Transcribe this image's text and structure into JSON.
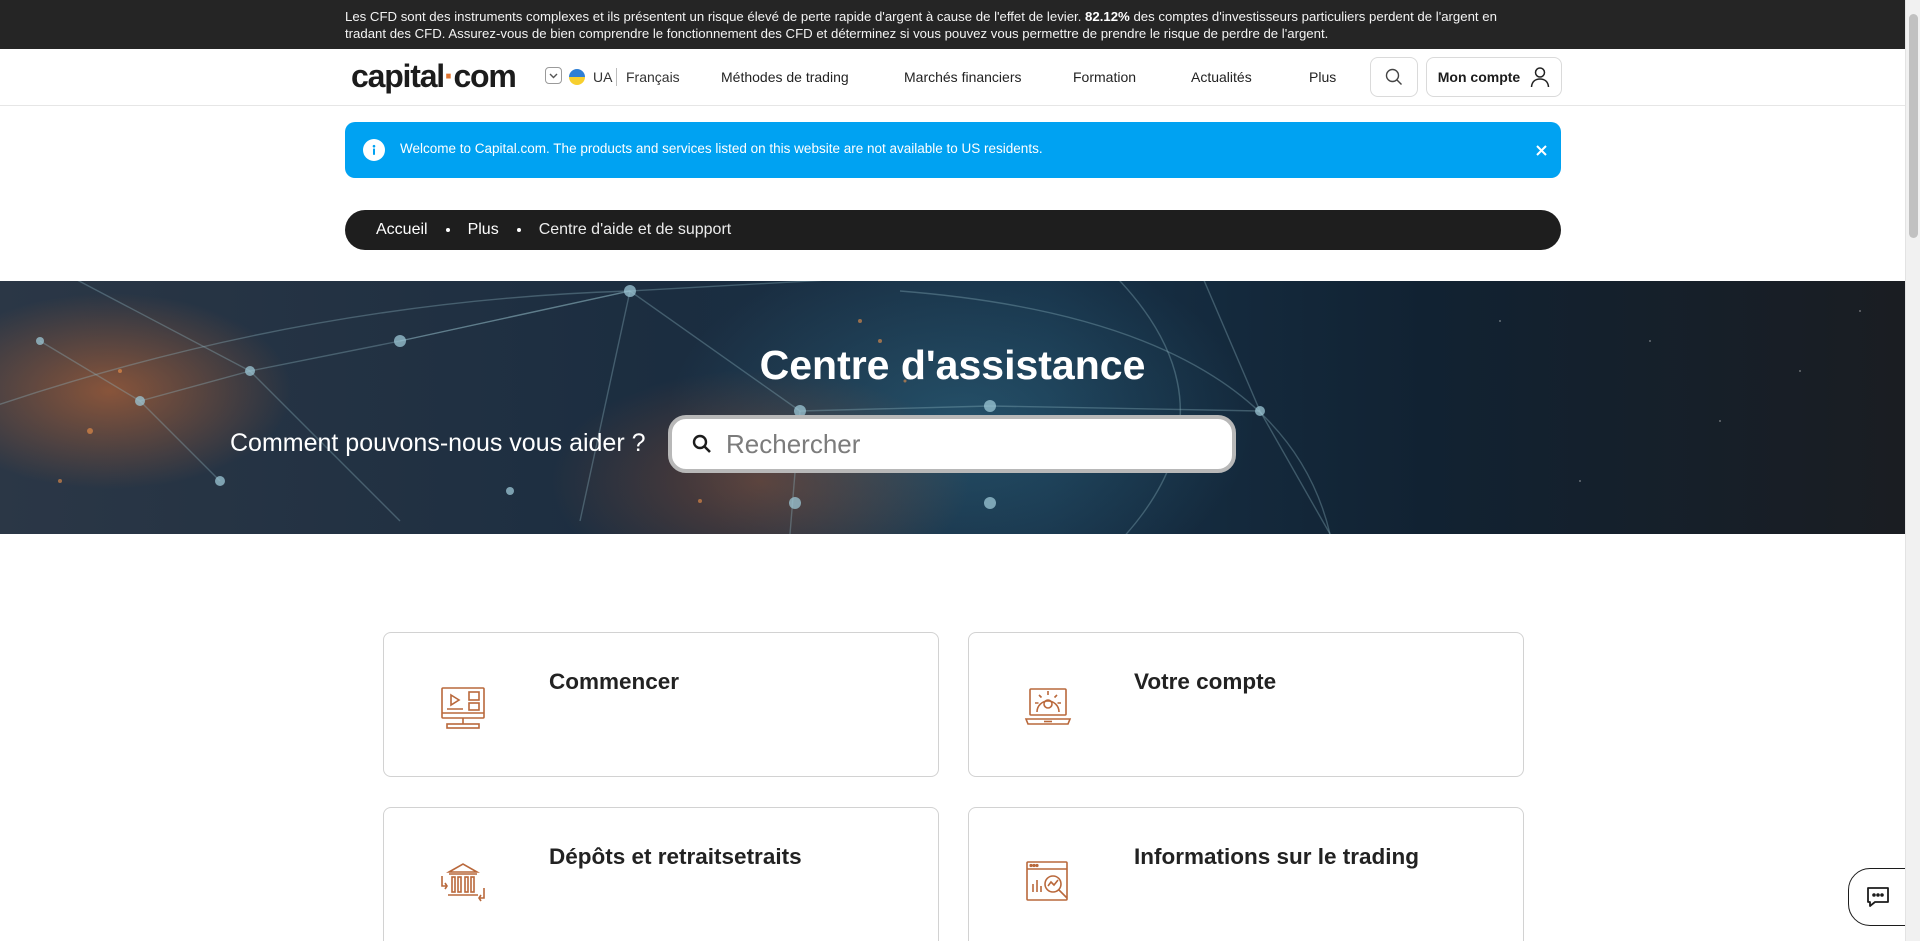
{
  "risk_warning": {
    "text_before": "Les CFD sont des instruments complexes et ils présentent un risque élevé de perte rapide d'argent à cause de l'effet de levier. ",
    "percentage": "82.12%",
    "text_after": " des comptes d'investisseurs particuliers perdent de l'argent en tradant des CFD. Assurez-vous de bien comprendre le fonctionnement des CFD et déterminez si vous pouvez vous permettre de prendre le risque de perdre de l'argent."
  },
  "header": {
    "logo_left": "capital",
    "logo_dot": "·",
    "logo_right": "com",
    "region_code": "UA",
    "language": "Français",
    "nav": [
      "Méthodes de trading",
      "Marchés financiers",
      "Formation",
      "Actualités",
      "Plus"
    ],
    "account_label": "Mon compte",
    "icons": {
      "search": "search-icon",
      "account": "user-icon",
      "region": "chevron-down-icon",
      "flag": "ukraine-flag-icon"
    }
  },
  "info_banner": {
    "text": "Welcome to Capital.com. The products and services listed on this website are not available to US residents.",
    "close_label": "×",
    "color": "#00a2f2"
  },
  "breadcrumb": [
    "Accueil",
    "Plus",
    "Centre d'aide et de support"
  ],
  "hero": {
    "title": "Centre d'assistance",
    "question": "Comment pouvons-nous vous aider ?",
    "search_placeholder": "Rechercher",
    "search_value": ""
  },
  "categories": [
    {
      "title": "Commencer",
      "icon": "video-screen-icon"
    },
    {
      "title": "Votre compte",
      "icon": "laptop-settings-icon"
    },
    {
      "title": "Dépôts et retraitsetraits",
      "icon": "bank-transfer-icon"
    },
    {
      "title": "Informations sur le trading",
      "icon": "chart-analysis-icon"
    }
  ],
  "chat": {
    "icon": "chat-icon"
  },
  "colors": {
    "accent": "#e0742f",
    "icon_brown": "#b9683b",
    "dark": "#1e1e1e",
    "banner": "#00a2f2"
  }
}
